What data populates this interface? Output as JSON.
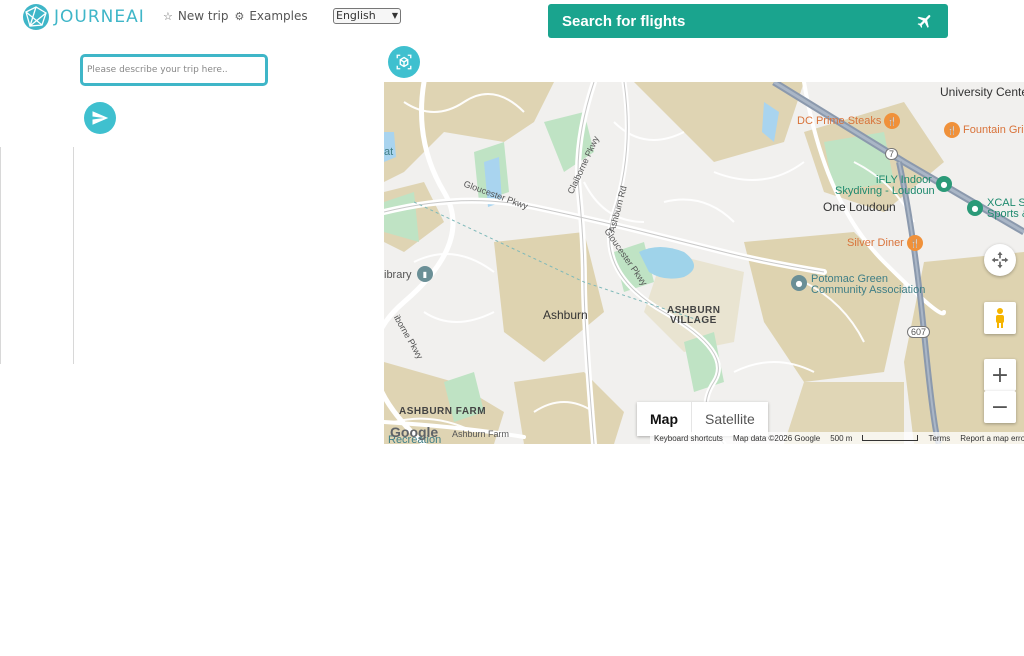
{
  "header": {
    "brand": "JOURNEAI",
    "nav": [
      {
        "label": "New trip",
        "icon": "star-icon"
      },
      {
        "label": "Examples",
        "icon": "puzzle-icon"
      }
    ],
    "language": {
      "selected": "English"
    },
    "flight_button": {
      "label": "Search for flights",
      "icon": "airplane-icon"
    }
  },
  "chat": {
    "input": {
      "placeholder": "Please describe your trip here..",
      "value": ""
    },
    "send_icon": "send-icon"
  },
  "map": {
    "labels": {
      "university_center": "University Center",
      "university_center_2": "Center",
      "dc_prime": "DC Prime Steaks",
      "fountain": "Fountain Gri",
      "ifly1": "iFLY Indoor",
      "ifly2": "Skydiving - Loudoun",
      "xcal1": "XCAL S",
      "xcal2": "Sports &",
      "one_loudoun": "One Loudoun",
      "silver_diner": "Silver Diner",
      "potomac1": "Potomac Green",
      "potomac2": "Community Association",
      "ashburn": "Ashburn",
      "ashburn_village1": "ASHBURN",
      "ashburn_village2": "VILLAGE",
      "ashburn_farm": "ASHBURN FARM",
      "ashburn_farm_rd": "Ashburn Farm",
      "recreation": "Recreation",
      "library": "ibrary",
      "at": "at",
      "gloucester1": "Gloucester Pkwy",
      "gloucester2": "Gloucester Pkwy",
      "claiborne": "Claiborne Pkwy",
      "ashburn_rd": "Ashburn Rd",
      "iborne": "iborne Pkwy",
      "route7": "7",
      "route607": "607"
    },
    "map_type": {
      "map": "Map",
      "satellite": "Satellite"
    },
    "attribution": {
      "google": "Google",
      "shortcuts": "Keyboard shortcuts",
      "data": "Map data ©2026 Google",
      "scale": "500 m",
      "terms": "Terms",
      "report": "Report a map error"
    },
    "controls": {
      "zoom_in": "+",
      "zoom_out": "−"
    }
  },
  "colors": {
    "brand": "#3fb6c8",
    "flight_button": "#1aa48e"
  }
}
